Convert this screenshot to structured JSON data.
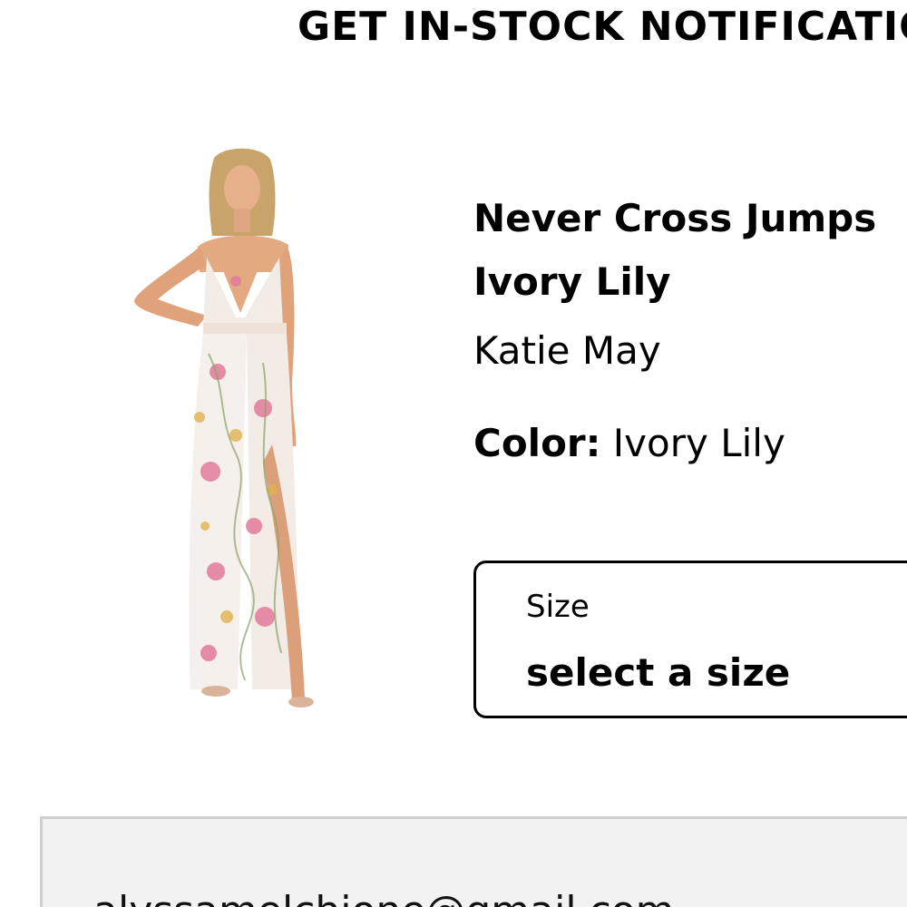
{
  "header": {
    "title": "GET IN-STOCK NOTIFICATIO"
  },
  "product": {
    "name_line1": "Never Cross Jumps",
    "name_line2": "Ivory Lily",
    "brand": "Katie May",
    "color_label": "Color:",
    "color_value": "Ivory Lily",
    "image_icon": "model-photo"
  },
  "size_select": {
    "label": "Size",
    "value": "select a size"
  },
  "email_field": {
    "value": "alyssamelchione@gmail.com"
  },
  "colors": {
    "email_bg": "#f2f2f2",
    "email_border": "#cfcfcf"
  }
}
